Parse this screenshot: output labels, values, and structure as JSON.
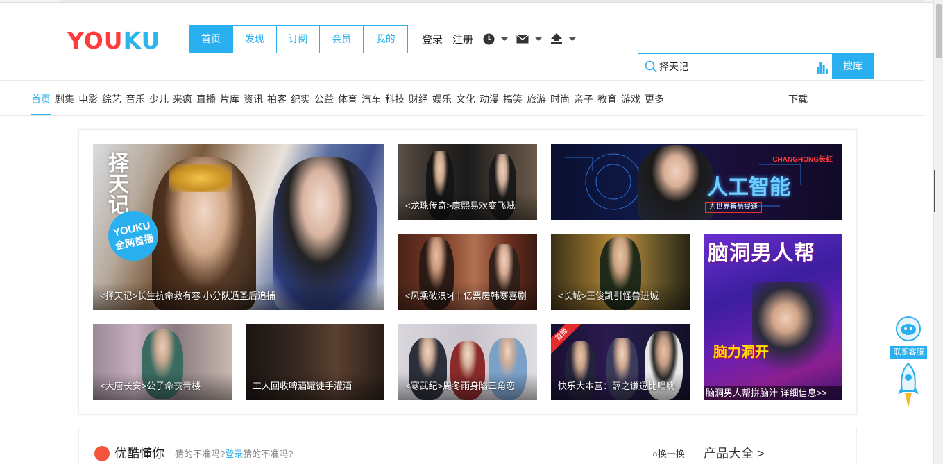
{
  "colors": {
    "accent": "#2ab0ee",
    "logo_red": "#ff3b3b",
    "logo_blue": "#2ab5ef"
  },
  "header": {
    "logo": "YOUKU",
    "tabs": [
      {
        "label": "首页",
        "active": true
      },
      {
        "label": "发现"
      },
      {
        "label": "订阅"
      },
      {
        "label": "会员"
      },
      {
        "label": "我的"
      }
    ],
    "login": "登录",
    "register": "注册",
    "icons": [
      "history-clock-icon",
      "mail-icon",
      "upload-icon"
    ],
    "search": {
      "value": "择天记",
      "button": "搜库"
    }
  },
  "channels": [
    "首页",
    "剧集",
    "电影",
    "综艺",
    "音乐",
    "少儿",
    "来疯",
    "直播",
    "片库",
    "资讯",
    "拍客",
    "纪实",
    "公益",
    "体育",
    "汽车",
    "科技",
    "财经",
    "娱乐",
    "文化",
    "动漫",
    "搞笑",
    "旅游",
    "时尚",
    "亲子",
    "教育",
    "游戏",
    "更多"
  ],
  "download": "下载",
  "feed": {
    "hero": {
      "caption": "<择天记>长生抗命救有容 小分队遁圣后追捕",
      "badge_line1": "YOUKU",
      "badge_line2": "全网首播",
      "title_art": "择天记"
    },
    "tiles": [
      {
        "caption": "<龙珠传奇>康熙易欢变飞贼"
      },
      {
        "caption": "<风乘破浪>[十亿票房韩寒喜剧"
      },
      {
        "caption": "<长城>王俊凯引怪兽进城"
      },
      {
        "caption": "<大唐长安>公子命丧青楼"
      },
      {
        "caption": "工人回收啤酒罐徒手灌酒"
      },
      {
        "caption": "<寒武纪>周冬雨身陷三角恋"
      },
      {
        "caption": "快乐大本营：薛之谦逗比唱嗨",
        "tag": "首播"
      }
    ],
    "banner": {
      "brand": "CHANGHONG长虹",
      "slogan": "为世界智慧提速",
      "art": "人工智能"
    },
    "poster": {
      "title": "脑洞男人帮",
      "sub": "脑力洞开",
      "caption": "脑洞男人帮拼脑汁  详细信息>>"
    }
  },
  "service": {
    "label": "联系客服"
  },
  "bottom": {
    "title": "优酷懂你",
    "subtitle_before": "猜的不准吗?",
    "subtitle_login": "登录",
    "subtitle_after": "猜的不准吗?",
    "refresh": "换一换",
    "products": "产品大全 >"
  }
}
